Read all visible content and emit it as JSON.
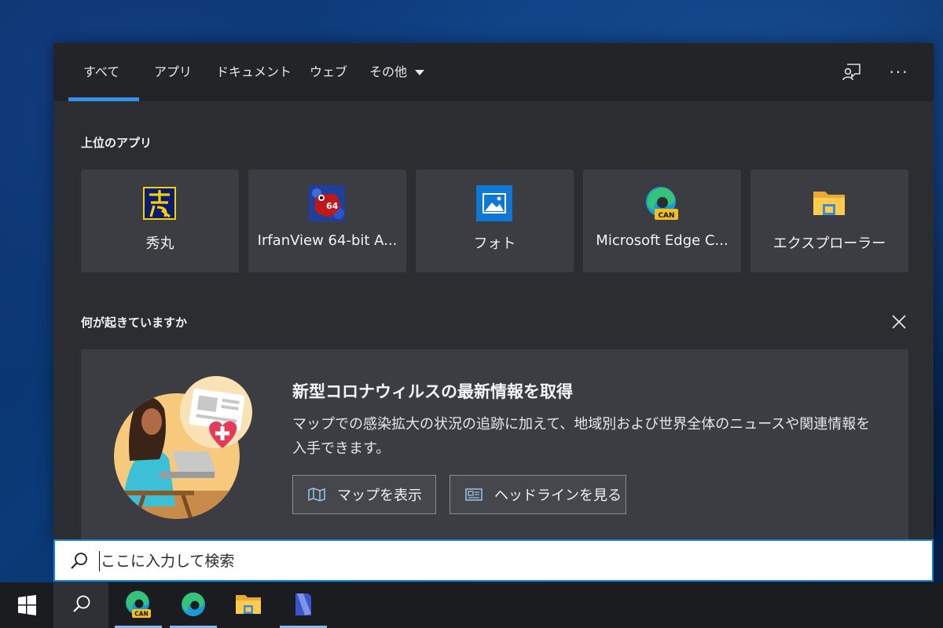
{
  "tabs": [
    {
      "label": "すべて",
      "active": true
    },
    {
      "label": "アプリ"
    },
    {
      "label": "ドキュメント"
    },
    {
      "label": "ウェブ"
    },
    {
      "label": "その他"
    }
  ],
  "top_apps": {
    "title": "上位のアプリ",
    "items": [
      {
        "label": "秀丸",
        "icon": "hidemaru-icon"
      },
      {
        "label": "IrfanView 64-bit A...",
        "icon": "irfanview-icon",
        "badge": "64"
      },
      {
        "label": "フォト",
        "icon": "photos-icon"
      },
      {
        "label": "Microsoft Edge C...",
        "icon": "edge-canary-icon",
        "badge": "CAN"
      },
      {
        "label": "エクスプローラー",
        "icon": "file-explorer-icon"
      }
    ]
  },
  "news": {
    "section_title": "何が起きていますか",
    "title": "新型コロナウィルスの最新情報を取得",
    "body": "マップでの感染拡大の状況の追跡に加えて、地域別および世界全体のニュースや関連情報を入手できます。",
    "buttons": [
      {
        "label": "マップを表示",
        "icon": "map-icon"
      },
      {
        "label": "ヘッドラインを見る",
        "icon": "newspaper-icon"
      }
    ]
  },
  "search": {
    "placeholder": "ここに入力して検索"
  },
  "taskbar": {
    "items": [
      {
        "icon": "windows-start-icon"
      },
      {
        "icon": "search-icon"
      },
      {
        "icon": "edge-canary-icon",
        "badge": "CAN"
      },
      {
        "icon": "edge-icon"
      },
      {
        "icon": "file-explorer-icon"
      },
      {
        "icon": "notepad-icon"
      }
    ]
  },
  "colors": {
    "accent": "#3a8ee6",
    "panel": "#2b2d31",
    "tile": "#3b3d42",
    "taskbar": "#1b1c20"
  }
}
